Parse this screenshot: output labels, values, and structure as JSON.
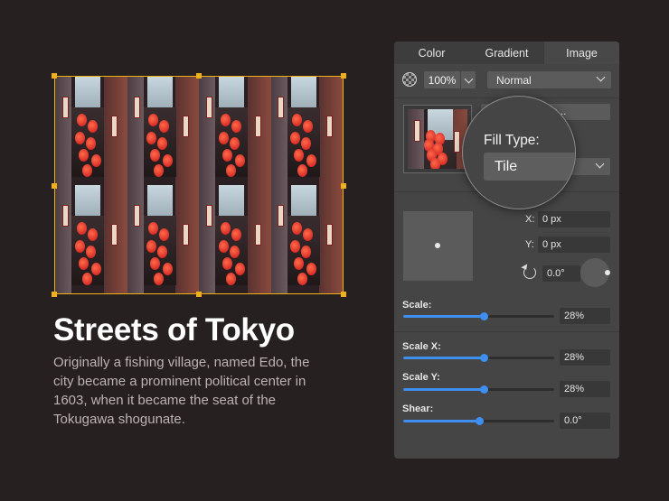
{
  "canvas": {
    "title": "Streets of Tokyo",
    "description": "Originally a fishing village, named Edo, the city became a prominent political center in 1603, when it became the seat of the Tokugawa shogunate.",
    "tile_columns": 4,
    "tile_rows": 2,
    "selection_color": "#f0b018"
  },
  "panel": {
    "tabs": [
      {
        "label": "Color",
        "active": false
      },
      {
        "label": "Gradient",
        "active": false
      },
      {
        "label": "Image",
        "active": true
      }
    ],
    "opacity": "100%",
    "blend_mode": "Normal",
    "choose_image_label": "Choose Image...",
    "fill_type_label": "Fill Type:",
    "fill_type_value": "Tile",
    "x_label": "X:",
    "x_value": "0 px",
    "y_label": "Y:",
    "y_value": "0 px",
    "rotation_value": "0.0°",
    "sliders": [
      {
        "id": "scale",
        "label": "Scale:",
        "value": "28%",
        "fraction": 0.53
      },
      {
        "id": "scale-x",
        "label": "Scale X:",
        "value": "28%",
        "fraction": 0.53
      },
      {
        "id": "scale-y",
        "label": "Scale Y:",
        "value": "28%",
        "fraction": 0.53
      },
      {
        "id": "shear",
        "label": "Shear:",
        "value": "0.0°",
        "fraction": 0.5
      }
    ],
    "accent_color": "#3f8ef2"
  },
  "icons": {
    "opacity": "checkerboard-circle-icon",
    "dropdown": "chevron-down-icon",
    "rotation": "rotate-ccw-icon"
  }
}
